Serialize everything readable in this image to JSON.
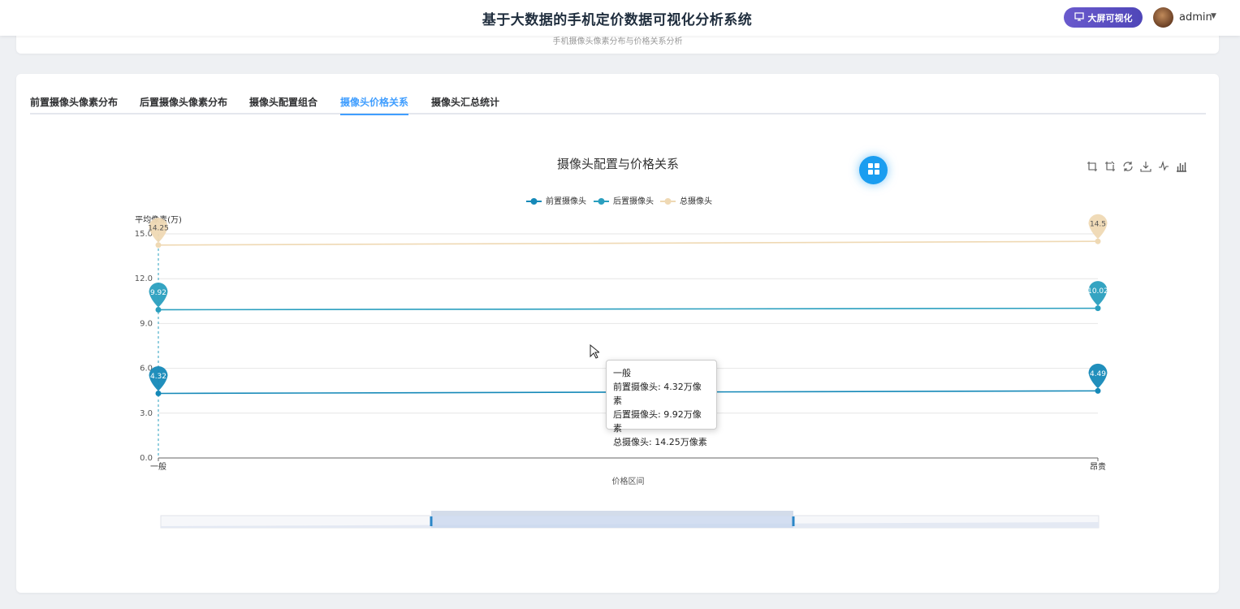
{
  "header": {
    "title": "基于大数据的手机定价数据可视化分析系统",
    "bigscreen_label": "大屏可视化",
    "user_name": "admin"
  },
  "top_card": {
    "caption": "手机摄像头像素分布与价格关系分析"
  },
  "tabs": [
    {
      "label": "前置摄像头像素分布",
      "active": false
    },
    {
      "label": "后置摄像头像素分布",
      "active": false
    },
    {
      "label": "摄像头配置组合",
      "active": false
    },
    {
      "label": "摄像头价格关系",
      "active": true
    },
    {
      "label": "摄像头汇总统计",
      "active": false
    }
  ],
  "toolbox_icons": [
    "zoom-icon",
    "zoom-reset-icon",
    "restore-icon",
    "download-icon",
    "line-chart-icon",
    "bar-chart-icon"
  ],
  "chart_data": {
    "type": "line",
    "title": "摄像头配置与价格关系",
    "xlabel": "价格区间",
    "ylabel": "平均像素(万)",
    "categories": [
      "一般",
      "昂贵"
    ],
    "ylim": [
      0,
      15
    ],
    "yticks": [
      "0.0",
      "3.0",
      "6.0",
      "9.0",
      "12.0",
      "15.0"
    ],
    "grid": true,
    "legend_position": "top-center",
    "series": [
      {
        "name": "前置摄像头",
        "values": [
          4.32,
          4.49
        ],
        "color": "#1589b8"
      },
      {
        "name": "后置摄像头",
        "values": [
          9.92,
          10.02
        ],
        "color": "#2a9fbf"
      },
      {
        "name": "总摄像头",
        "values": [
          14.25,
          14.5
        ],
        "color": "#efd9b4"
      }
    ]
  },
  "tooltip": {
    "title": "一般",
    "lines": [
      "前置摄像头: 4.32万像素",
      "后置摄像头: 9.92万像素",
      "总摄像头: 14.25万像素"
    ]
  }
}
